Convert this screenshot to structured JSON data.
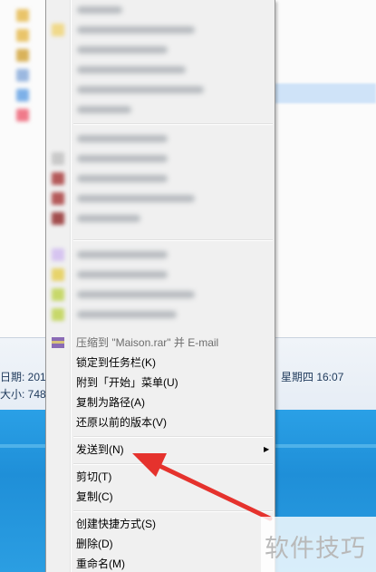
{
  "explorer": {
    "status_date_label": "日期: 201",
    "status_size_label": "大小: 748",
    "status_date_right": "星期四 16:07"
  },
  "context_menu": {
    "items": [
      {
        "label": "压缩到 \"Maison.rar\" 并 E-mail",
        "state": "partially-obscured",
        "icon": "winrar-archive-icon"
      },
      {
        "label": "锁定到任务栏(K)",
        "icon": "none"
      },
      {
        "label": "附到「开始」菜单(U)",
        "icon": "none"
      },
      {
        "label": "复制为路径(A)",
        "icon": "none"
      },
      {
        "label": "还原以前的版本(V)",
        "icon": "none"
      },
      {
        "label": "发送到(N)",
        "icon": "none",
        "has_submenu": true,
        "submenu_glyph": "▶"
      },
      {
        "label": "剪切(T)",
        "icon": "none"
      },
      {
        "label": "复制(C)",
        "icon": "none"
      },
      {
        "label": "创建快捷方式(S)",
        "icon": "none"
      },
      {
        "label": "删除(D)",
        "icon": "none"
      },
      {
        "label": "重命名(M)",
        "icon": "none"
      }
    ]
  },
  "annotation": {
    "arrow_color": "#e5322d",
    "points_to": "发送到(N)"
  },
  "watermark": {
    "text": "软件技巧"
  },
  "colors": {
    "menu_background": "#f0f0f0",
    "desktop_blue": "#1f8fd8",
    "annotation_red": "#e5322d"
  }
}
